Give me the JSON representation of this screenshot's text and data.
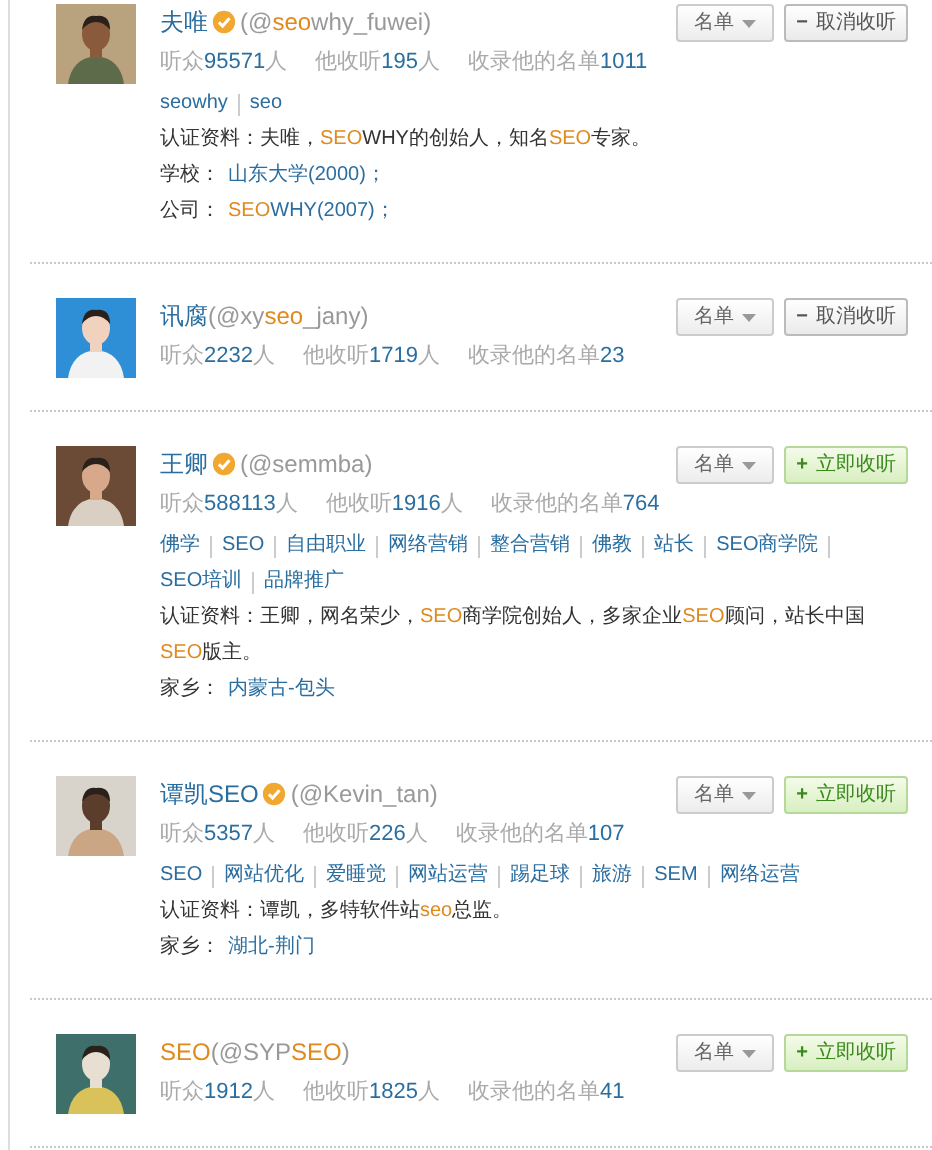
{
  "users": [
    {
      "name": [
        {
          "text": "夫唯"
        }
      ],
      "verified": true,
      "handle": [
        {
          "text": "(@"
        },
        {
          "text": "seo",
          "hl": true
        },
        {
          "text": "why_fuwei)"
        }
      ],
      "list_button": "名单",
      "follow": {
        "following": true,
        "icon": "−",
        "label": "取消收听"
      },
      "stats": [
        {
          "label": "听众",
          "value": "95571",
          "unit": "人"
        },
        {
          "label": "他收听",
          "value": "195",
          "unit": "人"
        },
        {
          "label": "收录他的名单",
          "value": "1011"
        }
      ],
      "tags": [
        "seowhy",
        "seo"
      ],
      "info": [
        {
          "label": "认证资料：",
          "kind": "text",
          "segments": [
            {
              "text": "夫唯，"
            },
            {
              "text": "SEO",
              "hl": true
            },
            {
              "text": "WHY的创始人，知名"
            },
            {
              "text": "SEO",
              "hl": true
            },
            {
              "text": "专家。"
            }
          ]
        },
        {
          "label": "学校：",
          "kind": "link",
          "segments": [
            {
              "text": "山东大学(2000)；"
            }
          ]
        },
        {
          "label": "公司：",
          "kind": "link",
          "segments": [
            {
              "text": "SEO",
              "hl": true
            },
            {
              "text": "WHY(2007)；"
            }
          ]
        }
      ]
    },
    {
      "name": [
        {
          "text": "讯腐"
        }
      ],
      "verified": false,
      "handle": [
        {
          "text": "(@xy"
        },
        {
          "text": "seo",
          "hl": true
        },
        {
          "text": "_jany)"
        }
      ],
      "list_button": "名单",
      "follow": {
        "following": true,
        "icon": "−",
        "label": "取消收听"
      },
      "stats": [
        {
          "label": "听众",
          "value": "2232",
          "unit": "人"
        },
        {
          "label": "他收听",
          "value": "1719",
          "unit": "人"
        },
        {
          "label": "收录他的名单",
          "value": "23"
        }
      ]
    },
    {
      "name": [
        {
          "text": "王卿"
        }
      ],
      "verified": true,
      "handle": [
        {
          "text": "(@semmba)"
        }
      ],
      "list_button": "名单",
      "follow": {
        "following": false,
        "icon": "+",
        "label": "立即收听"
      },
      "stats": [
        {
          "label": "听众",
          "value": "588113",
          "unit": "人"
        },
        {
          "label": "他收听",
          "value": "1916",
          "unit": "人"
        },
        {
          "label": "收录他的名单",
          "value": "764"
        }
      ],
      "tags": [
        "佛学",
        "SEO",
        "自由职业",
        "网络营销",
        "整合营销",
        "佛教",
        "站长",
        "SEO商学院",
        "SEO培训",
        "品牌推广"
      ],
      "info": [
        {
          "label": "认证资料：",
          "kind": "text",
          "segments": [
            {
              "text": "王卿，网名荣少，"
            },
            {
              "text": "SEO",
              "hl": true
            },
            {
              "text": "商学院创始人，多家企业"
            },
            {
              "text": "SEO",
              "hl": true
            },
            {
              "text": "顾问，站长中国"
            },
            {
              "text": "SEO",
              "hl": true
            },
            {
              "text": "版主。"
            }
          ]
        },
        {
          "label": "家乡：",
          "kind": "link",
          "segments": [
            {
              "text": "内蒙古-包头"
            }
          ]
        }
      ]
    },
    {
      "name": [
        {
          "text": "谭凯SEO"
        }
      ],
      "verified": true,
      "handle": [
        {
          "text": "(@Kevin_tan)"
        }
      ],
      "list_button": "名单",
      "follow": {
        "following": false,
        "icon": "+",
        "label": "立即收听"
      },
      "stats": [
        {
          "label": "听众",
          "value": "5357",
          "unit": "人"
        },
        {
          "label": "他收听",
          "value": "226",
          "unit": "人"
        },
        {
          "label": "收录他的名单",
          "value": "107"
        }
      ],
      "tags": [
        "SEO",
        "网站优化",
        "爱睡觉",
        "网站运营",
        "踢足球",
        "旅游",
        "SEM",
        "网络运营"
      ],
      "info": [
        {
          "label": "认证资料：",
          "kind": "text",
          "segments": [
            {
              "text": "谭凯，多特软件站"
            },
            {
              "text": "seo",
              "hl": true
            },
            {
              "text": "总监。"
            }
          ]
        },
        {
          "label": "家乡：",
          "kind": "link",
          "segments": [
            {
              "text": "湖北-荆门"
            }
          ]
        }
      ]
    },
    {
      "name": [
        {
          "text": "SEO",
          "hl": true
        }
      ],
      "verified": false,
      "handle": [
        {
          "text": "(@SYP"
        },
        {
          "text": "SEO",
          "hl": true
        },
        {
          "text": ")"
        }
      ],
      "list_button": "名单",
      "follow": {
        "following": false,
        "icon": "+",
        "label": "立即收听"
      },
      "stats": [
        {
          "label": "听众",
          "value": "1912",
          "unit": "人"
        },
        {
          "label": "他收听",
          "value": "1825",
          "unit": "人"
        },
        {
          "label": "收录他的名单",
          "value": "41"
        }
      ]
    }
  ]
}
